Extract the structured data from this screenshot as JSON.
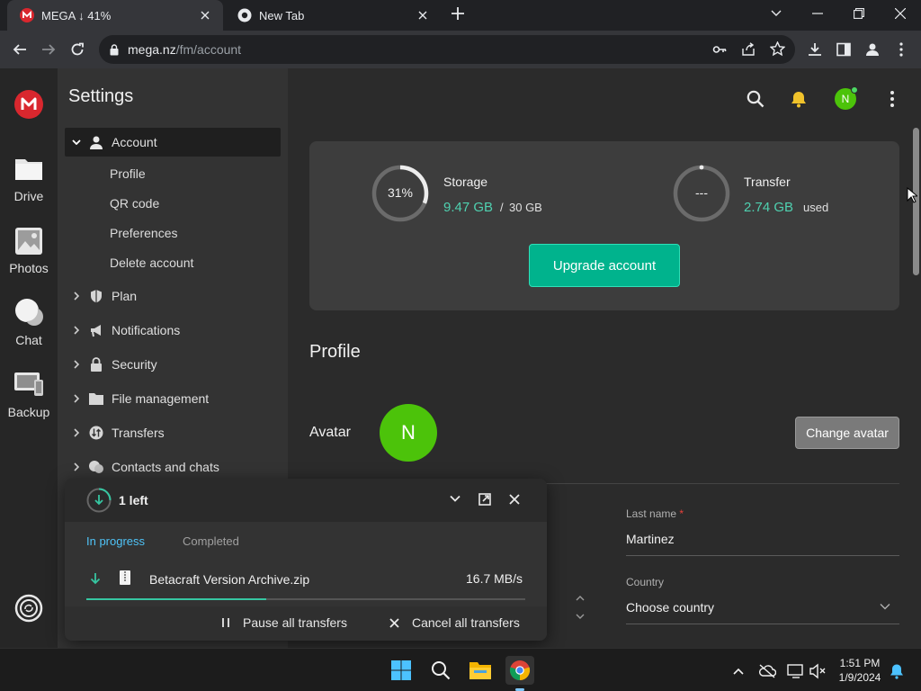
{
  "browser": {
    "tabs": [
      {
        "title": "MEGA ↓ 41%",
        "favicon": "mega-logo-icon",
        "active": true
      },
      {
        "title": "New Tab",
        "favicon": "chrome-icon",
        "active": false
      }
    ],
    "url_host": "mega.nz",
    "url_path": "/fm/account"
  },
  "rail": {
    "items": [
      {
        "label": "Drive",
        "icon": "folder-icon"
      },
      {
        "label": "Photos",
        "icon": "photos-icon"
      },
      {
        "label": "Chat",
        "icon": "chat-icon"
      },
      {
        "label": "Backup",
        "icon": "backup-icon"
      }
    ]
  },
  "settings": {
    "title": "Settings",
    "nav": [
      {
        "label": "Account",
        "icon": "user-icon",
        "expanded": true
      },
      {
        "label": "Plan",
        "icon": "shield-icon"
      },
      {
        "label": "Notifications",
        "icon": "megaphone-icon"
      },
      {
        "label": "Security",
        "icon": "lock-icon"
      },
      {
        "label": "File management",
        "icon": "folder-icon"
      },
      {
        "label": "Transfers",
        "icon": "transfer-icon"
      },
      {
        "label": "Contacts and chats",
        "icon": "chat-icon"
      }
    ],
    "account_sub": [
      "Profile",
      "QR code",
      "Preferences",
      "Delete account"
    ]
  },
  "quota": {
    "storage": {
      "label": "Storage",
      "percent_text": "31%",
      "percent": 31,
      "used": "9.47 GB",
      "separator": "/",
      "total": "30 GB"
    },
    "transfer": {
      "label": "Transfer",
      "ring_text": "---",
      "used": "2.74 GB",
      "suffix": "used"
    },
    "upgrade_label": "Upgrade account"
  },
  "profile": {
    "heading": "Profile",
    "avatar_label": "Avatar",
    "avatar_initial": "N",
    "change_avatar_label": "Change avatar",
    "last_name_label": "Last name",
    "required_mark": "*",
    "last_name_value": "Martinez",
    "country_label": "Country",
    "country_value": "Choose country"
  },
  "header": {
    "user_initial": "N"
  },
  "transfers": {
    "count_text": "1 left",
    "tab_in_progress": "In progress",
    "tab_completed": "Completed",
    "file_name": "Betacraft Version Archive.zip",
    "speed": "16.7 MB/s",
    "progress": 0.41,
    "pause_label": "Pause all transfers",
    "cancel_label": "Cancel all transfers"
  },
  "taskbar": {
    "time": "1:51 PM",
    "date": "1/9/2024"
  },
  "colors": {
    "mega_red": "#d9272e",
    "accent_teal": "#00b38d",
    "value_teal": "#4fd1b0",
    "avatar_green": "#4cc30a"
  }
}
